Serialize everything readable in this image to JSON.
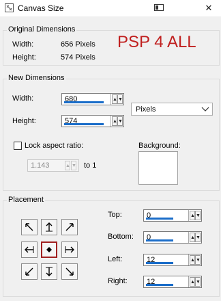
{
  "window": {
    "title": "Canvas Size",
    "close_glyph": "✕"
  },
  "watermark": "PSP 4 ALL",
  "original_dimensions": {
    "heading": "Original Dimensions",
    "width_label": "Width:",
    "width_value": "656 Pixels",
    "height_label": "Height:",
    "height_value": "574 Pixels"
  },
  "new_dimensions": {
    "heading": "New Dimensions",
    "width_label": "Width:",
    "width_value": "680",
    "height_label": "Height:",
    "height_value": "574",
    "units_selected": "Pixels",
    "lock_label": "Lock aspect ratio:",
    "lock_checked": false,
    "ratio_value": "1.143",
    "ratio_suffix": "to 1",
    "background_label": "Background:",
    "background_color": "#ffffff"
  },
  "placement": {
    "heading": "Placement",
    "selected_anchor": "center",
    "top_label": "Top:",
    "top_value": "0",
    "bottom_label": "Bottom:",
    "bottom_value": "0",
    "left_label": "Left:",
    "left_value": "12",
    "right_label": "Right:",
    "right_value": "12"
  },
  "colors": {
    "accent": "#1a6dc9",
    "selected_border": "#a02020",
    "watermark": "#c0201f"
  }
}
